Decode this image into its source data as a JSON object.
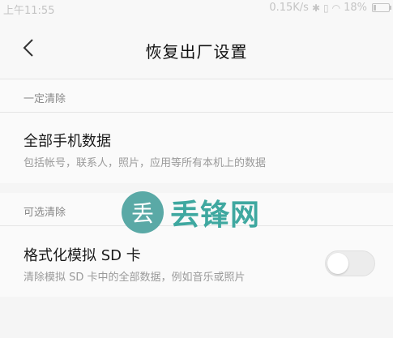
{
  "status_bar": {
    "time": "上午11:55",
    "network_speed": "0.15K/s",
    "battery": "18%",
    "battery_level": 0.18,
    "icons": [
      "bluetooth-icon",
      "vibrate-icon",
      "wifi-icon",
      "battery-icon"
    ]
  },
  "header": {
    "title": "恢复出厂设置",
    "back_icon": "chevron-left-icon"
  },
  "sections": [
    {
      "header": "一定清除",
      "item": {
        "title": "全部手机数据",
        "description": "包括帐号，联系人，照片，应用等所有本机上的数据"
      }
    },
    {
      "header": "可选清除",
      "item": {
        "title": "格式化模拟 SD 卡",
        "description": "清除模拟 SD 卡中的全部数据，例如音乐或照片",
        "toggle_on": false
      }
    }
  ],
  "watermark": {
    "badge": "丢",
    "text": "丢锋网"
  },
  "colors": {
    "background": "#f5f5f5",
    "divider": "#e5e5e5",
    "watermark": "#3fa8a0"
  }
}
